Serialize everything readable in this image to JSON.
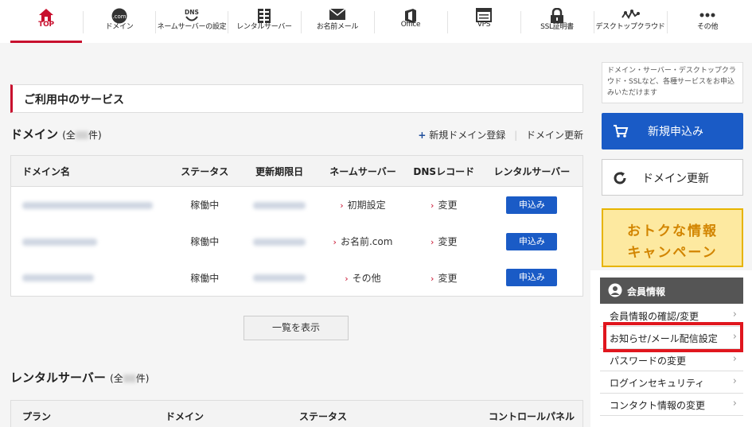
{
  "nav": {
    "items": [
      {
        "label": "TOP",
        "icon": "home-icon"
      },
      {
        "label": "ドメイン",
        "icon": "domain-icon"
      },
      {
        "label": "ネームサーバーの設定",
        "icon": "dns-icon"
      },
      {
        "label": "レンタルサーバー",
        "icon": "server-icon"
      },
      {
        "label": "お名前メール",
        "icon": "mail-icon"
      },
      {
        "label": "Office",
        "icon": "office-icon"
      },
      {
        "label": "VPS",
        "icon": "vps-icon"
      },
      {
        "label": "SSL証明書",
        "icon": "lock-icon"
      },
      {
        "label": "デスクトップクラウド",
        "icon": "cloud-icon"
      },
      {
        "label": "その他",
        "icon": "more-icon"
      }
    ],
    "icon_text": {
      "domain": ".com",
      "dns": "DNS"
    }
  },
  "services": {
    "title": "ご利用中のサービス"
  },
  "domains": {
    "title": "ドメイン",
    "count_prefix": "(全",
    "count_suffix": "件)",
    "add_link": "新規ドメイン登録",
    "renew_link": "ドメイン更新",
    "columns": [
      "ドメイン名",
      "ステータス",
      "更新期限日",
      "ネームサーバー",
      "DNSレコード",
      "レンタルサーバー"
    ],
    "rows": [
      {
        "status": "稼働中",
        "nameserver": "初期設定",
        "dns": "変更",
        "action": "申込み"
      },
      {
        "status": "稼働中",
        "nameserver": "お名前.com",
        "dns": "変更",
        "action": "申込み"
      },
      {
        "status": "稼働中",
        "nameserver": "その他",
        "dns": "変更",
        "action": "申込み"
      }
    ],
    "show_all": "一覧を表示"
  },
  "rental": {
    "title": "レンタルサーバー",
    "count_prefix": "(全",
    "count_suffix": "件)",
    "columns": [
      "プラン",
      "ドメイン",
      "ステータス",
      "コントロールパネル"
    ]
  },
  "sidebar": {
    "promo_text": "ドメイン・サーバー・デスクトップクラウド・SSLなど、各種サービスをお申込みいただけます",
    "new_button": "新規申込み",
    "renew_button": "ドメイン更新",
    "campaign_line1": "おトクな情報",
    "campaign_line2": "キャンペーン",
    "member_title": "会員情報",
    "member_items": [
      "会員情報の確認/変更",
      "お知らせ/メール配信設定",
      "パスワードの変更",
      "ログインセキュリティ",
      "コンタクト情報の変更"
    ]
  },
  "colors": {
    "accent": "#c8102e",
    "primary": "#1a5bc6",
    "highlight": "#e0161e"
  }
}
